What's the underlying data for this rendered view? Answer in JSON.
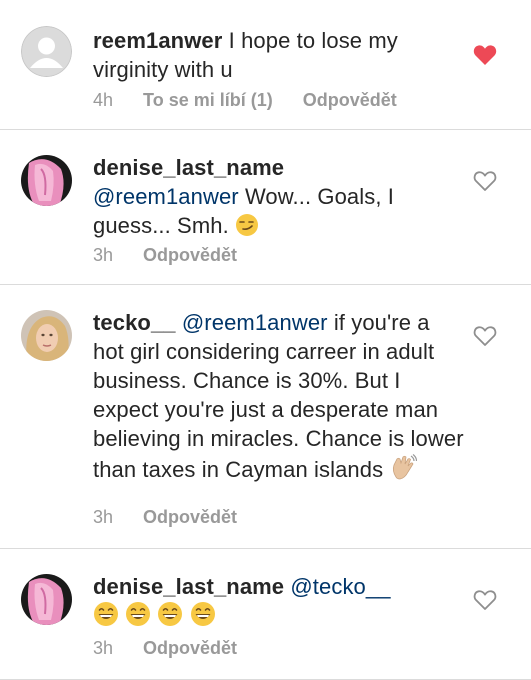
{
  "colors": {
    "username": "#262626",
    "mention": "#003569",
    "meta": "#999999",
    "liked_heart": "#ed4956",
    "divider": "#dbdbdb"
  },
  "comments": [
    {
      "username": "reem1anwer",
      "text": "I hope to lose my virginity with u",
      "time": "4h",
      "likes_label": "To se mi líbí (1)",
      "reply_label": "Odpovědět",
      "liked": true,
      "avatar": "default-avatar"
    },
    {
      "username": "denise_last_name",
      "mention": "@reem1anwer",
      "text": "Wow... Goals, I guess... Smh.",
      "emoji": [
        "smirk"
      ],
      "time": "3h",
      "reply_label": "Odpovědět",
      "liked": false,
      "avatar": "pink-hair-avatar"
    },
    {
      "username": "tecko__",
      "mention": "@reem1anwer",
      "text": "if you're a hot girl considering carreer in adult business. Chance is 30%. But I expect you're just a desperate man believing in miracles. Chance is lower than taxes in Cayman islands",
      "emoji": [
        "waving-hand"
      ],
      "time": "3h",
      "reply_label": "Odpovědět",
      "liked": false,
      "avatar": "blonde-avatar"
    },
    {
      "username": "denise_last_name",
      "mention": "@tecko__",
      "text": "",
      "emoji": [
        "grin",
        "grin",
        "grin",
        "grin"
      ],
      "time": "3h",
      "reply_label": "Odpovědět",
      "liked": false,
      "avatar": "pink-hair-avatar"
    }
  ]
}
